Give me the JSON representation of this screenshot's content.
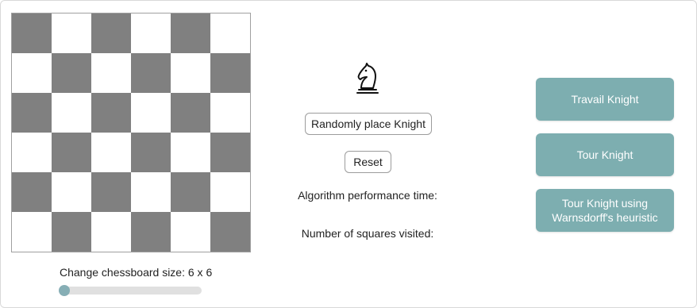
{
  "board": {
    "rows": 6,
    "cols": 6,
    "dark_color": "#808080",
    "light_color": "#ffffff"
  },
  "size_control": {
    "label": "Change chessboard size: 6 x 6",
    "value": 6,
    "min": 6,
    "max": 12
  },
  "knight": {
    "icon": "chess-knight-icon"
  },
  "buttons": {
    "random_place": "Randomly place Knight",
    "reset": "Reset",
    "travail": "Travail Knight",
    "tour": "Tour Knight",
    "warnsdorff": "Tour Knight using Warnsdorff's heuristic"
  },
  "info": {
    "time_label": "Algorithm performance time:",
    "squares_label": "Number of squares visited:"
  },
  "colors": {
    "accent": "#7daeb0",
    "slider_thumb": "#86aeb5",
    "slider_track": "#e0e0e0"
  }
}
